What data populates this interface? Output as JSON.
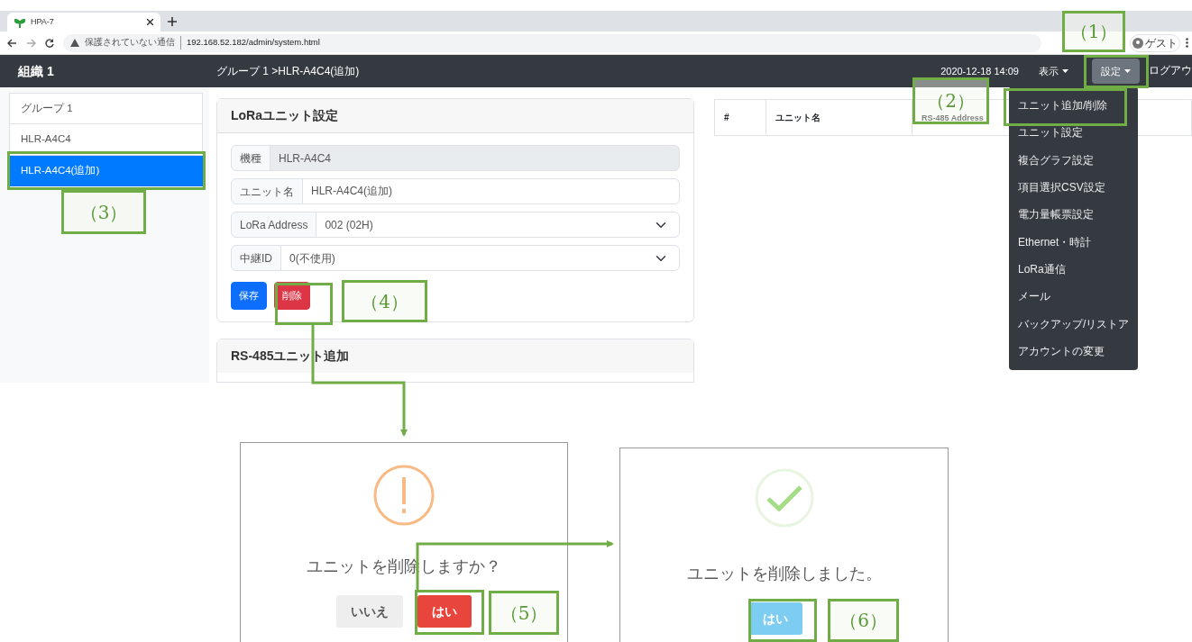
{
  "browser": {
    "tab_title": "HPA-7",
    "security": "保護されていない通信",
    "url": "192.168.52.182/admin/system.html",
    "profile": "ゲスト"
  },
  "navbar": {
    "brand": "組織 1",
    "breadcrumb": "グループ 1 >HLR-A4C4(追加)",
    "datetime": "2020-12-18 14:09",
    "menus": [
      {
        "label": "表示",
        "expanded": false
      },
      {
        "label": "設定",
        "expanded": true
      }
    ],
    "logout": "ログアウ",
    "dropdown": [
      "ユニット追加/削除",
      "ユニット設定",
      "複合グラフ設定",
      "項目選択CSV設定",
      "電力量帳票設定",
      "Ethernet・時計",
      "LoRa通信",
      "メール",
      "バックアップ/リストア",
      "アカウントの変更"
    ]
  },
  "sidebar": {
    "items": [
      {
        "label": "グループ 1",
        "selected": false
      },
      {
        "label": "HLR-A4C4",
        "selected": false
      },
      {
        "label": "HLR-A4C4(追加)",
        "selected": true
      }
    ]
  },
  "unit_card": {
    "title": "LoRaユニット設定",
    "fields": [
      {
        "kind": "readonly",
        "label": "機種",
        "value": "HLR-A4C4"
      },
      {
        "kind": "text",
        "label": "ユニット名",
        "value": "HLR-A4C4(追加)"
      },
      {
        "kind": "select",
        "label": "LoRa Address",
        "value": "002 (02H)"
      },
      {
        "kind": "select",
        "label": "中継ID",
        "value": "0(不使用)"
      }
    ],
    "buttons": [
      {
        "label": "保存",
        "kind": "primary"
      },
      {
        "label": "削除",
        "kind": "danger"
      }
    ]
  },
  "rs485_card": {
    "title": "RS-485ユニット追加"
  },
  "table": {
    "columns": [
      "#",
      "ユニット名",
      "RS-485 Address"
    ]
  },
  "dialogs": [
    {
      "kind": "warning",
      "message": "ユニットを削除しますか？",
      "buttons": [
        {
          "label": "いいえ",
          "kind": "cancel"
        },
        {
          "label": "はい",
          "kind": "confirm"
        }
      ]
    },
    {
      "kind": "success",
      "message": "ユニットを削除しました。",
      "buttons": [
        {
          "label": "はい",
          "kind": "ok"
        }
      ]
    }
  ],
  "callouts": [
    "（1）",
    "（2）",
    "（3）",
    "（4）",
    "（5）",
    "（6）"
  ]
}
